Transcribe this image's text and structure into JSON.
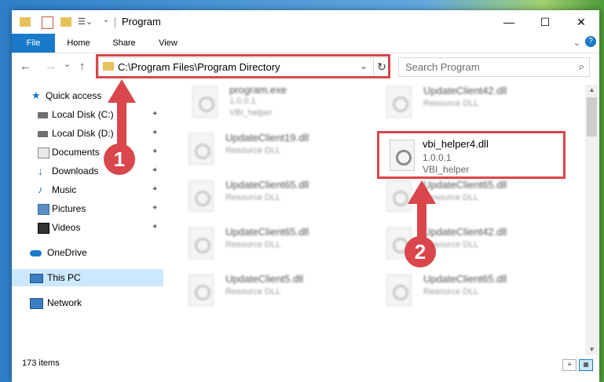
{
  "window": {
    "title": "Program"
  },
  "title_buttons": {
    "minimize": "—",
    "maximize": "☐",
    "close": "✕"
  },
  "ribbon": {
    "tabs": [
      "File",
      "Home",
      "Share",
      "View"
    ]
  },
  "nav": {
    "back": "←",
    "forward": "→",
    "recent": "⌄",
    "up": "↑"
  },
  "address": {
    "path": "C:\\Program Files\\Program Directory",
    "refresh": "↻",
    "dropdown": "⌄"
  },
  "search": {
    "placeholder": "Search Program",
    "icon": "⌕"
  },
  "sidebar": {
    "items": [
      {
        "label": "Quick access",
        "icon": "star-icon"
      },
      {
        "label": "Local Disk (C:)",
        "icon": "drive-icon",
        "pinned": true
      },
      {
        "label": "Local Disk (D:)",
        "icon": "drive-icon",
        "pinned": true
      },
      {
        "label": "Documents",
        "icon": "documents-icon",
        "pinned": true
      },
      {
        "label": "Downloads",
        "icon": "download-icon",
        "pinned": true
      },
      {
        "label": "Music",
        "icon": "music-icon",
        "pinned": true
      },
      {
        "label": "Pictures",
        "icon": "pictures-icon",
        "pinned": true
      },
      {
        "label": "Videos",
        "icon": "videos-icon",
        "pinned": true
      },
      {
        "label": "OneDrive",
        "icon": "cloud-icon"
      },
      {
        "label": "This PC",
        "icon": "computer-icon",
        "selected": true
      },
      {
        "label": "Network",
        "icon": "network-icon"
      }
    ],
    "pin_glyph": "📌"
  },
  "files": [
    {
      "name": "program.exe",
      "line2": "1.0.0.1",
      "line3": "VBI_helper"
    },
    {
      "name": "UpdateClient42.dll",
      "line2": "Resource DLL",
      "line3": ""
    },
    {
      "name": "UpdateClient19.dll",
      "line2": "Resource DLL",
      "line3": ""
    },
    {
      "name": "UpdateClient65.dll",
      "line2": "Resource DLL",
      "line3": ""
    },
    {
      "name": "UpdateClient65.dll",
      "line2": "Resource DLL",
      "line3": ""
    },
    {
      "name": "UpdateClient65.dll",
      "line2": "Resource DLL",
      "line3": ""
    },
    {
      "name": "UpdateClient65.dll",
      "line2": "Resource DLL",
      "line3": ""
    },
    {
      "name": "UpdateClient42.dll",
      "line2": "Resource DLL",
      "line3": ""
    },
    {
      "name": "UpdateClient5.dll",
      "line2": "Resource DLL",
      "line3": ""
    },
    {
      "name": "UpdateClient65.dll",
      "line2": "Resource DLL",
      "line3": ""
    }
  ],
  "focused_file": {
    "name": "vbi_helper4.dll",
    "version": "1.0.0.1",
    "product": "VBI_helper"
  },
  "status": {
    "count": "173 items",
    "details_view": "≡",
    "tiles_view": "▦"
  },
  "annotations": {
    "badge1": "1",
    "badge2": "2"
  },
  "colors": {
    "highlight": "#d9464b",
    "accent": "#1979ca",
    "selected": "#cce8ff"
  }
}
